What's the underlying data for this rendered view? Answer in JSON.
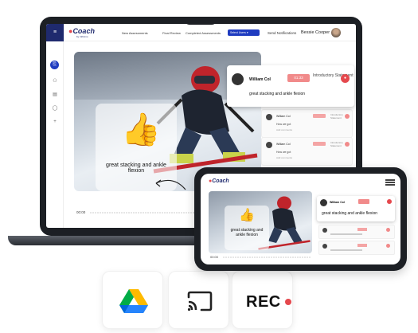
{
  "app": {
    "logo": "Coach",
    "logo_sub": "by Infinimo",
    "menu_label": "≡"
  },
  "nav": {
    "items": [
      "New Assessments",
      "Final Review",
      "Completed Assessments"
    ],
    "select_label": "Select Users",
    "send_notifications": "Send Notifications",
    "user_name": "Bessie Cooper"
  },
  "video": {
    "caption": "great stacking and ankle flexion",
    "timestamp": "00:00"
  },
  "comment_main": {
    "author": "William Col",
    "time": "01:33",
    "tag": "Introductory Statement",
    "text": "great stacking and ankle flexion"
  },
  "comment_rows": [
    {
      "author": "William Col",
      "tag": "Introductory Statement",
      "line1": "How we got",
      "line2": "Add comments"
    },
    {
      "author": "William Col",
      "tag": "Introductory Statement",
      "line1": "How we got",
      "line2": "Add comments"
    }
  ],
  "phone": {
    "logo": "Coach",
    "main_author": "William Col",
    "main_text": "great stacking and ankle flexion",
    "caption": "great stacking and ankle flexion",
    "timestamp": "00:00"
  },
  "tiles": {
    "rec_label": "REC"
  },
  "icons": [
    "google-drive-icon",
    "cast-icon",
    "rec-dot-icon"
  ],
  "colors": {
    "accent": "#e5484d",
    "brand": "#1f2a6e",
    "primary": "#1f3cc0"
  }
}
